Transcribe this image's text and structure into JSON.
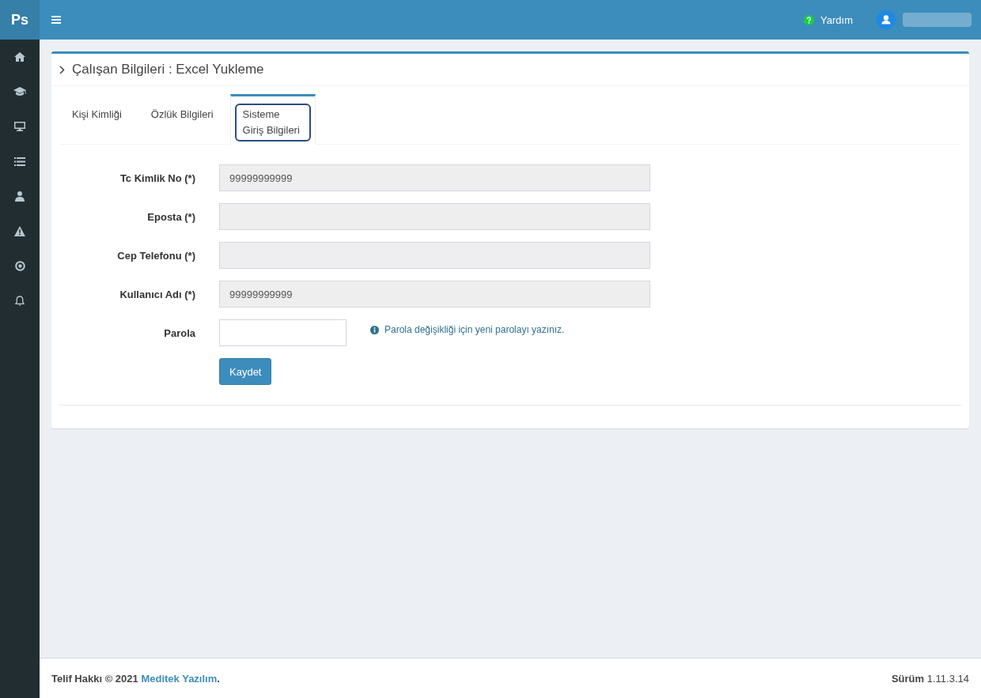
{
  "app": {
    "logo": "Ps"
  },
  "header": {
    "help": "Yardım"
  },
  "panel": {
    "title": "Çalışan Bilgileri : Excel Yukleme",
    "tabs": [
      {
        "label": "Kişi Kimliği",
        "selected": false,
        "focused": false
      },
      {
        "label": "Özlük Bilgileri",
        "selected": false,
        "focused": false
      },
      {
        "label": "Sisteme Giriş Bilgileri",
        "selected": true,
        "focused": true
      }
    ],
    "form": {
      "fields": [
        {
          "kind": "text",
          "label": "Tc Kimlik No (*)",
          "value": "99999999999",
          "disabled": true
        },
        {
          "kind": "text",
          "label": "Eposta (*)",
          "disabled": true
        },
        {
          "kind": "text",
          "label": "Cep Telefonu (*)",
          "disabled": true
        },
        {
          "kind": "text",
          "label": "Kullanıcı Adı (*)",
          "value": "99999999999",
          "disabled": true
        },
        {
          "kind": "password",
          "label": "Parola",
          "disabled": false,
          "hint": "Parola değişikliği için yeni parolayı yazınız."
        }
      ],
      "submit": "Kaydet"
    }
  },
  "footer": {
    "copyright": {
      "text": "Telif Hakkı © 2021",
      "link": "Meditek Yazılım",
      "end": "."
    },
    "version": "**Sürüm** 1.11.3.14"
  }
}
